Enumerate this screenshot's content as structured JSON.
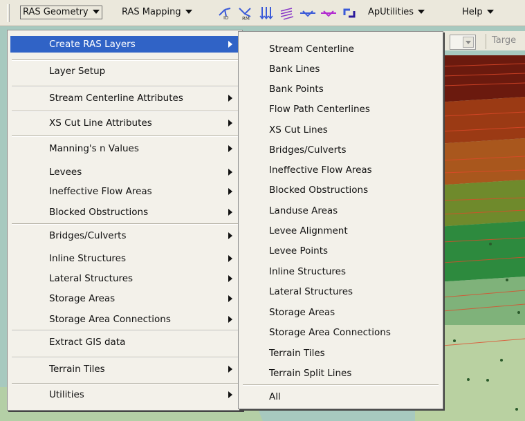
{
  "toolbar": {
    "menus": [
      {
        "label": "RAS Geometry"
      },
      {
        "label": "RAS Mapping"
      },
      {
        "label": "ApUtilities"
      },
      {
        "label": "Help"
      }
    ],
    "icons": [
      "id-tool-icon",
      "rm-tool-icon",
      "flow-arrows-icon",
      "spring-icon",
      "cross-section-icon",
      "cross-section-2-icon",
      "swap-arrows-icon"
    ]
  },
  "second_row": {
    "target_label": "Targe"
  },
  "main_menu": {
    "items": [
      {
        "label": "Create RAS Layers",
        "submenu": true,
        "active": true
      },
      {
        "label": "Layer Setup",
        "submenu": false
      },
      {
        "label": "Stream Centerline Attributes",
        "submenu": true
      },
      {
        "label": "XS Cut Line Attributes",
        "submenu": true
      },
      {
        "label": "Manning's n Values",
        "submenu": true
      },
      {
        "label": "Levees",
        "submenu": true
      },
      {
        "label": "Ineffective Flow Areas",
        "submenu": true
      },
      {
        "label": "Blocked Obstructions",
        "submenu": true
      },
      {
        "label": "Bridges/Culverts",
        "submenu": true
      },
      {
        "label": "Inline Structures",
        "submenu": true
      },
      {
        "label": "Lateral Structures",
        "submenu": true
      },
      {
        "label": "Storage Areas",
        "submenu": true
      },
      {
        "label": "Storage Area Connections",
        "submenu": true
      },
      {
        "label": "Extract GIS data",
        "submenu": false
      },
      {
        "label": "Terrain Tiles",
        "submenu": true
      },
      {
        "label": "Utilities",
        "submenu": true
      }
    ]
  },
  "sub_menu": {
    "items": [
      {
        "label": "Stream Centerline"
      },
      {
        "label": "Bank Lines"
      },
      {
        "label": "Bank Points"
      },
      {
        "label": "Flow Path Centerlines"
      },
      {
        "label": "XS Cut Lines"
      },
      {
        "label": "Bridges/Culverts"
      },
      {
        "label": "Ineffective Flow Areas"
      },
      {
        "label": "Blocked Obstructions"
      },
      {
        "label": "Landuse Areas"
      },
      {
        "label": "Levee Alignment"
      },
      {
        "label": "Levee Points"
      },
      {
        "label": "Inline Structures"
      },
      {
        "label": "Lateral Structures"
      },
      {
        "label": "Storage Areas"
      },
      {
        "label": "Storage Area Connections"
      },
      {
        "label": "Terrain Tiles"
      },
      {
        "label": "Terrain Split Lines"
      },
      {
        "label": "All"
      }
    ]
  },
  "colors": {
    "highlight": "#3063c6",
    "menu_bg": "#f3f1ea",
    "toolbar_bg": "#ebe8dc"
  }
}
